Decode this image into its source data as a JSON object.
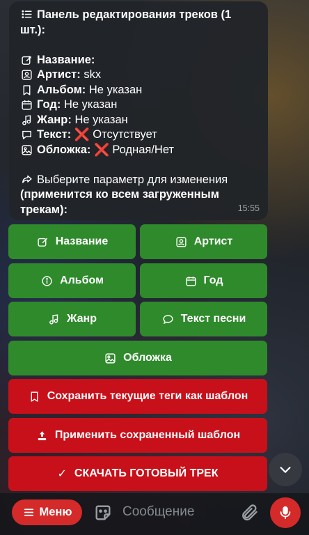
{
  "message": {
    "header": "Панель редактирования треков (1 шт.):",
    "fields": [
      {
        "icon": "edit-icon",
        "label": "Название:",
        "value": ""
      },
      {
        "icon": "artist-icon",
        "label": "Артист:",
        "value": "skx"
      },
      {
        "icon": "bookmark-icon",
        "label": "Альбом:",
        "value": "Не указан"
      },
      {
        "icon": "calendar-icon",
        "label": "Год:",
        "value": "Не указан"
      },
      {
        "icon": "music-note-icon",
        "label": "Жанр:",
        "value": "Не указан"
      },
      {
        "icon": "chat-icon",
        "label": "Текст:",
        "value": "Отсутствует",
        "status": "❌"
      },
      {
        "icon": "image-icon",
        "label": "Обложка:",
        "value": "Родная/Нет",
        "status": "❌"
      }
    ],
    "prompt_plain": "Выберите параметр для изменения",
    "prompt_bold": "(применится ко всем загруженным трекам):",
    "time": "15:55"
  },
  "buttons": {
    "title": "Название",
    "artist": "Артист",
    "album": "Альбом",
    "year": "Год",
    "genre": "Жанр",
    "lyrics": "Текст песни",
    "cover": "Обложка",
    "save_template": "Сохранить текущие теги как шаблон",
    "apply_template": "Применить сохраненный шаблон",
    "download": "СКАЧАТЬ ГОТОВЫЙ ТРЕК",
    "download_check": "✓"
  },
  "input_bar": {
    "menu_label": "Меню",
    "placeholder": "Сообщение"
  },
  "colors": {
    "green": "#2f8a2c",
    "red": "#c8101a",
    "menu_red": "#d42a2a",
    "bubble": "#212429"
  }
}
